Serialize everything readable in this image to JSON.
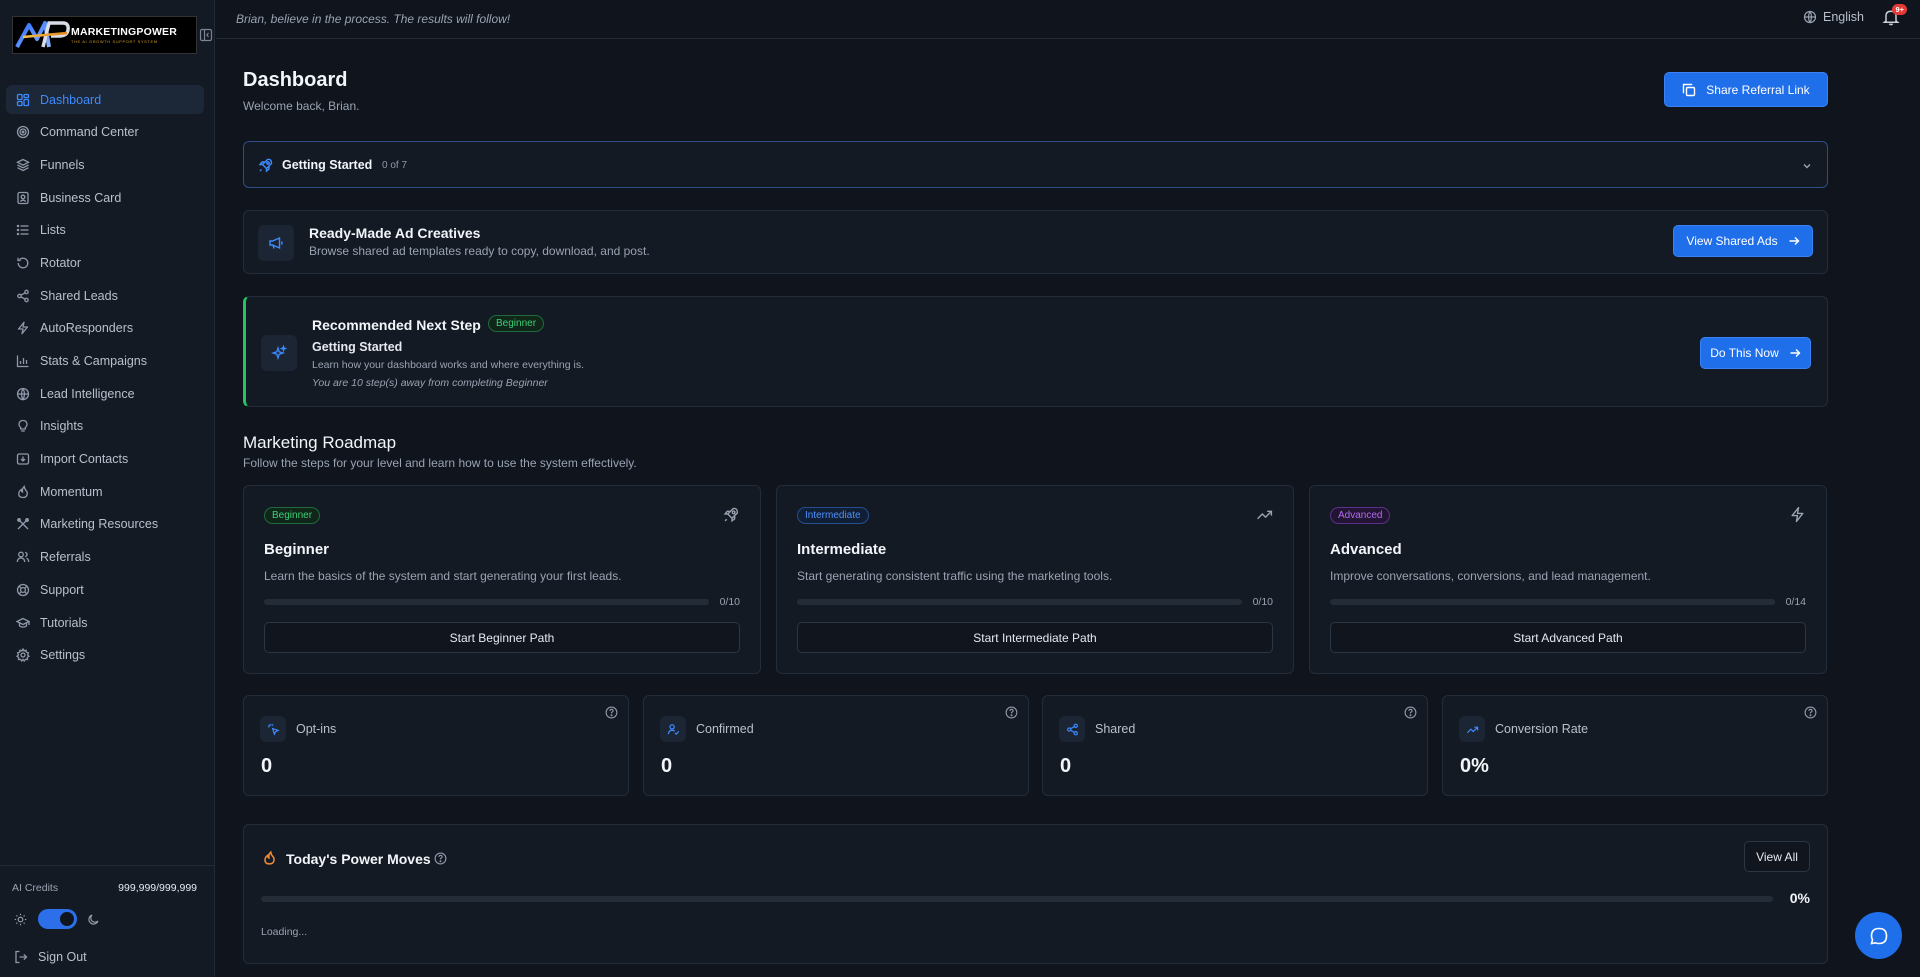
{
  "brand": {
    "logo_text": "MARKETINGPOWER",
    "logo_tagline": "THE AI GROWTH SUPPORT SYSTEM"
  },
  "colors": {
    "accent": "#1f6feb",
    "success": "#22c55e",
    "background": "#0f141d",
    "sidebar": "#141a24"
  },
  "topbar": {
    "motto": "Brian, believe in the process. The results will follow!",
    "language": "English",
    "notification_badge": "9+"
  },
  "sidebar": {
    "items": [
      {
        "label": "Dashboard",
        "icon": "grid-icon",
        "active": true
      },
      {
        "label": "Command Center",
        "icon": "target-icon"
      },
      {
        "label": "Funnels",
        "icon": "layers-icon"
      },
      {
        "label": "Business Card",
        "icon": "contact-card-icon"
      },
      {
        "label": "Lists",
        "icon": "list-icon"
      },
      {
        "label": "Rotator",
        "icon": "rotate-icon"
      },
      {
        "label": "Shared Leads",
        "icon": "share-icon"
      },
      {
        "label": "AutoResponders",
        "icon": "lightning-icon"
      },
      {
        "label": "Stats & Campaigns",
        "icon": "bar-chart-icon"
      },
      {
        "label": "Lead Intelligence",
        "icon": "globe-icon"
      },
      {
        "label": "Insights",
        "icon": "lightbulb-icon"
      },
      {
        "label": "Import Contacts",
        "icon": "import-icon"
      },
      {
        "label": "Momentum",
        "icon": "flame-icon"
      },
      {
        "label": "Marketing Resources",
        "icon": "tools-icon"
      },
      {
        "label": "Referrals",
        "icon": "users-icon"
      },
      {
        "label": "Support",
        "icon": "lifebuoy-icon"
      },
      {
        "label": "Tutorials",
        "icon": "graduation-cap-icon"
      },
      {
        "label": "Settings",
        "icon": "gear-icon"
      }
    ],
    "credits_label": "AI Credits",
    "credits_value": "999,999/999,999",
    "sign_out": "Sign Out"
  },
  "header": {
    "title": "Dashboard",
    "subtitle": "Welcome back, Brian.",
    "share_button": "Share Referral Link"
  },
  "getting_started": {
    "title": "Getting Started",
    "count": "0 of 7"
  },
  "ad_creatives": {
    "title": "Ready-Made Ad Creatives",
    "subtitle": "Browse shared ad templates ready to copy, download, and post.",
    "button": "View Shared Ads"
  },
  "recommended": {
    "title": "Recommended Next Step",
    "badge": "Beginner",
    "step": "Getting Started",
    "description": "Learn how your dashboard works and where everything is.",
    "note": "You are 10 step(s) away from completing Beginner",
    "button": "Do This Now"
  },
  "roadmap": {
    "title": "Marketing Roadmap",
    "subtitle": "Follow the steps for your level and learn how to use the system effectively.",
    "paths": [
      {
        "badge": "Beginner",
        "title": "Beginner",
        "description": "Learn the basics of the system and start generating your first leads.",
        "progress": "0/10",
        "progress_fraction": 0,
        "button": "Start Beginner Path"
      },
      {
        "badge": "Intermediate",
        "title": "Intermediate",
        "description": "Start generating consistent traffic using the marketing tools.",
        "progress": "0/10",
        "progress_fraction": 0,
        "button": "Start Intermediate Path"
      },
      {
        "badge": "Advanced",
        "title": "Advanced",
        "description": "Improve conversations, conversions, and lead management.",
        "progress": "0/14",
        "progress_fraction": 0,
        "button": "Start Advanced Path"
      }
    ]
  },
  "stats": [
    {
      "label": "Opt-ins",
      "value": "0"
    },
    {
      "label": "Confirmed",
      "value": "0"
    },
    {
      "label": "Shared",
      "value": "0"
    },
    {
      "label": "Conversion Rate",
      "value": "0%"
    }
  ],
  "power_moves": {
    "title": "Today's Power Moves",
    "button": "View All",
    "percent": "0%",
    "progress_fraction": 0,
    "status": "Loading..."
  }
}
